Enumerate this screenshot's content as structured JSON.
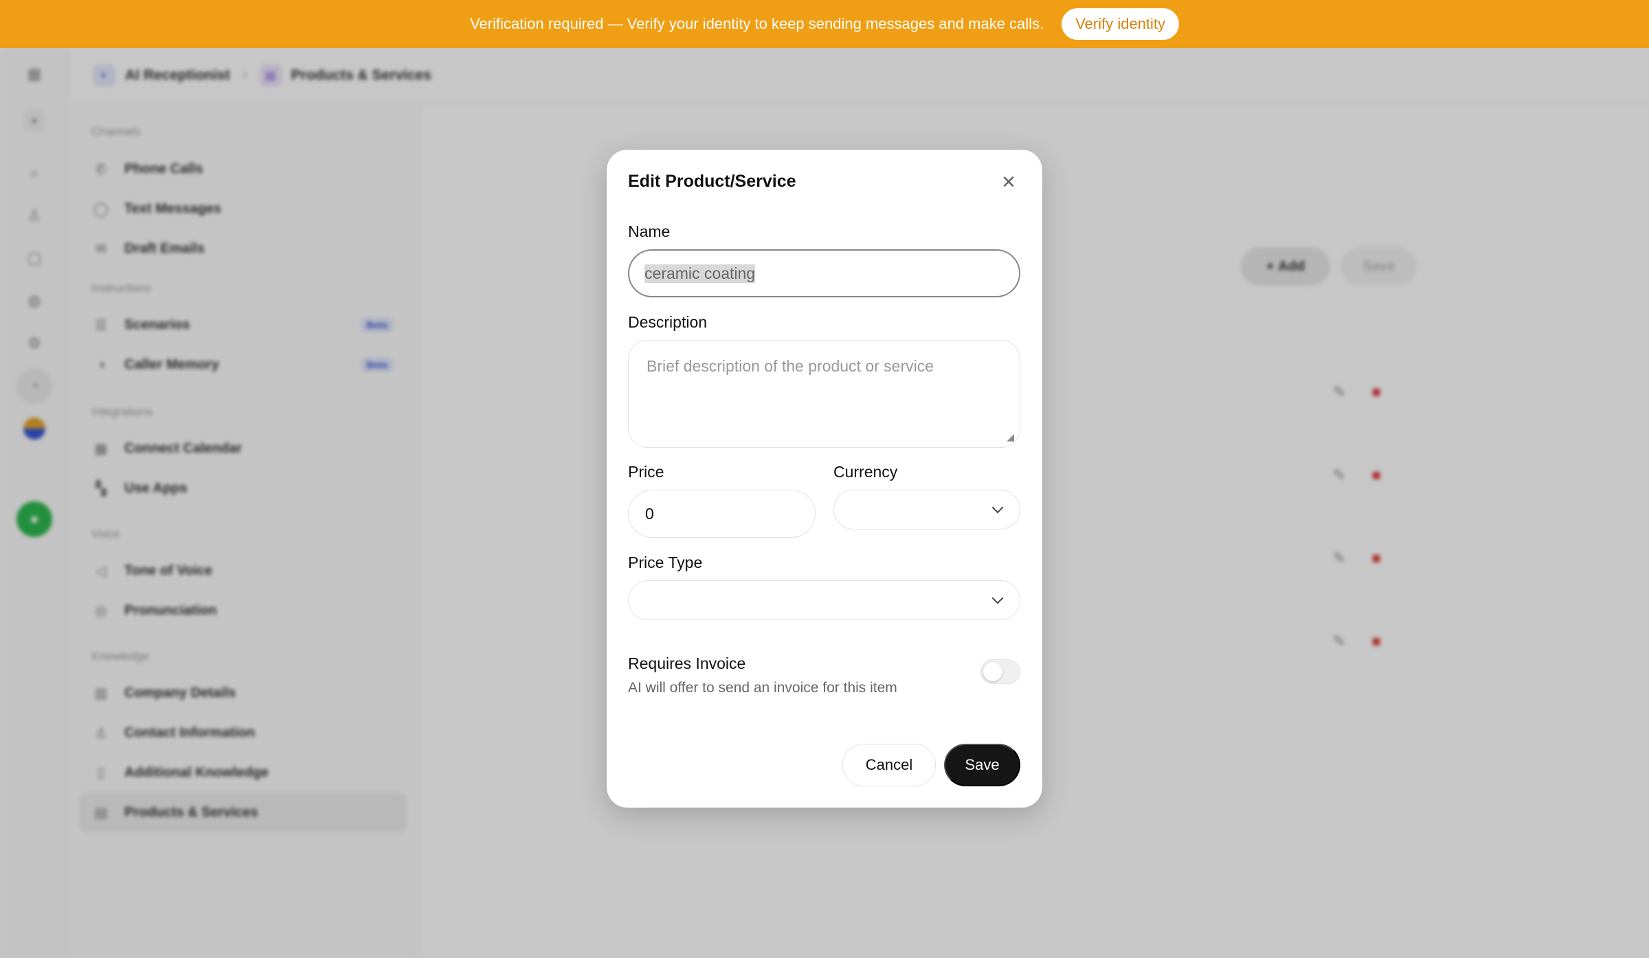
{
  "banner": {
    "message": "Verification required — Verify your identity to keep sending messages and make calls.",
    "button_label": "Verify identity"
  },
  "breadcrumb": {
    "items": [
      {
        "label": "AI Receptionist",
        "icon": "ai-receptionist-icon"
      },
      {
        "label": "Products & Services",
        "icon": "products-services-icon"
      }
    ],
    "separator": "›"
  },
  "sidebar": {
    "sections": [
      {
        "label": "Channels",
        "items": [
          {
            "label": "Phone Calls",
            "icon": "phone-icon"
          },
          {
            "label": "Text Messages",
            "icon": "chat-bubble-icon"
          },
          {
            "label": "Draft Emails",
            "icon": "mail-icon"
          }
        ]
      },
      {
        "label": "Instructions",
        "items": [
          {
            "label": "Scenarios",
            "icon": "list-icon",
            "badge": "Beta"
          },
          {
            "label": "Caller Memory",
            "icon": "memory-icon",
            "badge": "Beta"
          }
        ]
      },
      {
        "label": "Integrations",
        "items": [
          {
            "label": "Connect Calendar",
            "icon": "calendar-icon"
          },
          {
            "label": "Use Apps",
            "icon": "apps-icon"
          }
        ]
      },
      {
        "label": "Voice",
        "items": [
          {
            "label": "Tone of Voice",
            "icon": "speaker-icon"
          },
          {
            "label": "Pronunciation",
            "icon": "pronunciation-icon"
          }
        ]
      },
      {
        "label": "Knowledge",
        "items": [
          {
            "label": "Company Details",
            "icon": "building-icon"
          },
          {
            "label": "Contact Information",
            "icon": "person-icon"
          },
          {
            "label": "Additional Knowledge",
            "icon": "document-icon"
          },
          {
            "label": "Products & Services",
            "icon": "box-icon",
            "active": true
          }
        ]
      }
    ]
  },
  "content": {
    "add_label": "Add",
    "save_label": "Save"
  },
  "modal": {
    "title": "Edit Product/Service",
    "name_label": "Name",
    "name_value": "ceramic coating",
    "description_label": "Description",
    "description_placeholder": "Brief description of the product or service",
    "price_label": "Price",
    "price_value": "0",
    "currency_label": "Currency",
    "currency_value": "",
    "price_type_label": "Price Type",
    "price_type_value": "",
    "invoice_title": "Requires Invoice",
    "invoice_subtitle": "AI will offer to send an invoice for this item",
    "invoice_enabled": false,
    "cancel_label": "Cancel",
    "save_label": "Save"
  },
  "colors": {
    "banner": "#f09e14",
    "primary_button": "#161616",
    "delete": "#e13c3c",
    "beta_badge": "#3a56d4"
  }
}
